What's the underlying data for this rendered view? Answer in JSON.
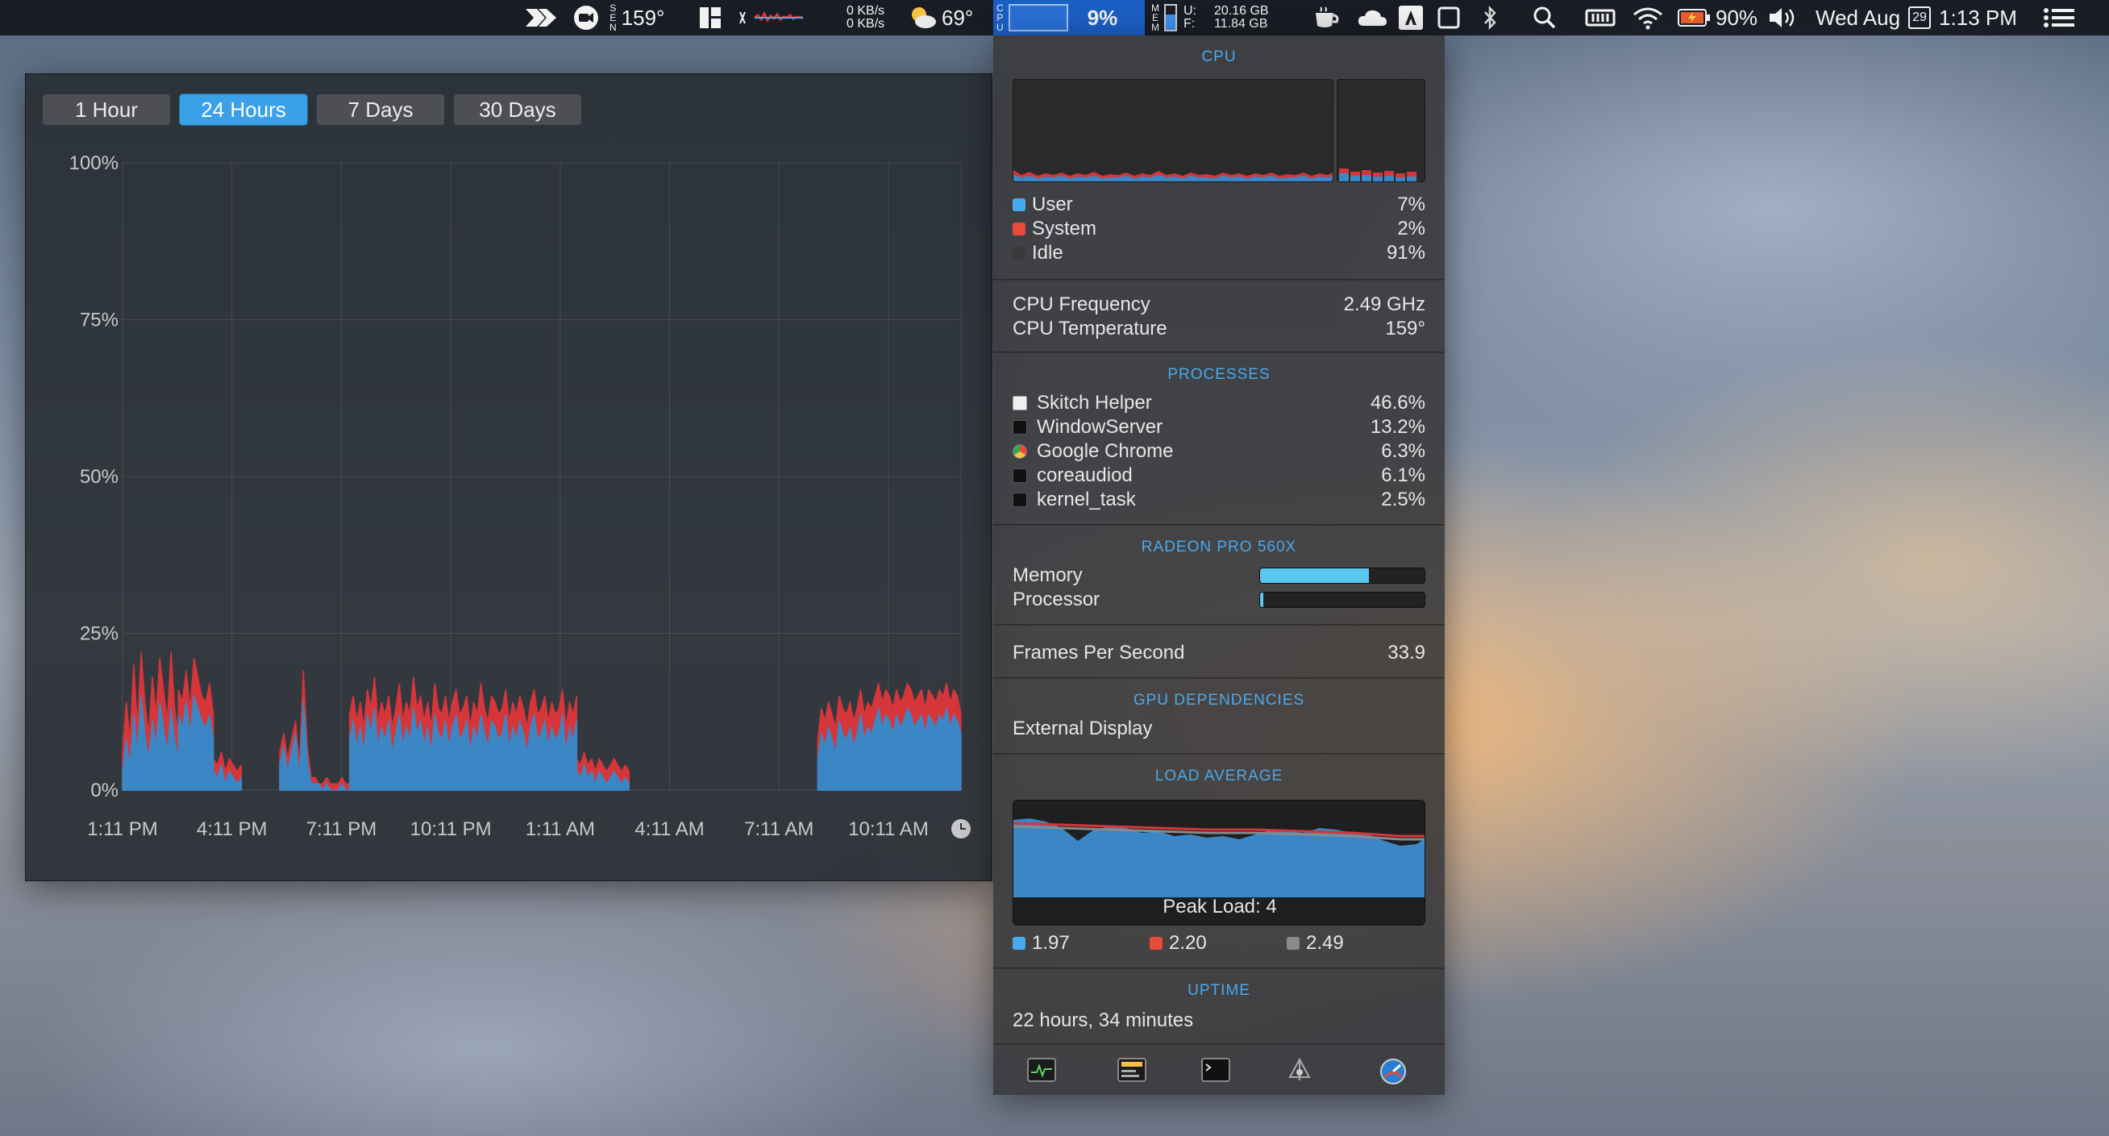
{
  "menubar": {
    "sensor_label": [
      "S",
      "E",
      "N"
    ],
    "temp": "159°",
    "net_up": "0 KB/s",
    "net_down": "0 KB/s",
    "weather": "69°",
    "cpu_label": [
      "C",
      "P",
      "U"
    ],
    "cpu_value": "9%",
    "mem_label": [
      "M",
      "E",
      "M"
    ],
    "mem_used_key": "U:",
    "mem_free_key": "F:",
    "mem_used": "20.16 GB",
    "mem_free": "11.84 GB",
    "battery": "90%",
    "date": "Wed Aug",
    "day_num": "29",
    "time": "1:13 PM"
  },
  "history": {
    "tabs": [
      {
        "label": "1 Hour",
        "active": false
      },
      {
        "label": "24 Hours",
        "active": true
      },
      {
        "label": "7 Days",
        "active": false
      },
      {
        "label": "30 Days",
        "active": false
      }
    ]
  },
  "chart_data": {
    "type": "area",
    "title": "",
    "y_ticks": [
      "100%",
      "75%",
      "50%",
      "25%",
      "0%"
    ],
    "ylim": [
      0,
      100
    ],
    "x_ticks": [
      "1:11 PM",
      "4:11 PM",
      "7:11 PM",
      "10:11 PM",
      "1:11 AM",
      "4:11 AM",
      "7:11 AM",
      "10:11 AM"
    ],
    "grid": true,
    "series": [
      {
        "color": "#3b86c4",
        "segments": [
          {
            "start": 0.0,
            "end": 1.6,
            "values": [
              3,
              8,
              4,
              12,
              6,
              15,
              9,
              5,
              11,
              7,
              14,
              10,
              6,
              13,
              8,
              5
            ]
          },
          {
            "start": 1.6,
            "end": 2.6,
            "values": [
              12,
              10,
              14,
              9,
              15,
              13,
              11,
              10,
              12,
              8
            ]
          },
          {
            "start": 2.6,
            "end": 3.4,
            "values": [
              3,
              2,
              4,
              1,
              3,
              2,
              1,
              2
            ]
          },
          {
            "start": 4.5,
            "end": 5.4,
            "values": [
              4,
              7,
              3,
              6,
              9,
              2,
              14,
              5,
              1
            ]
          },
          {
            "start": 5.4,
            "end": 6.5,
            "values": [
              1,
              1,
              1,
              0,
              1,
              0,
              0,
              0,
              1,
              0,
              0
            ]
          },
          {
            "start": 6.5,
            "end": 13.0,
            "values": [
              8,
              11,
              7,
              10,
              6,
              12,
              9,
              13,
              7,
              10,
              8,
              11,
              6,
              9,
              12,
              7,
              10,
              8,
              13,
              9,
              11,
              7,
              10,
              6,
              12,
              9,
              8,
              11,
              7,
              10,
              12,
              8,
              9,
              11,
              6,
              10,
              8,
              12,
              9,
              7,
              11,
              10,
              8,
              9,
              12,
              7,
              10,
              8,
              11,
              9,
              6,
              10,
              12,
              8,
              9,
              11,
              7,
              10,
              8,
              9,
              12,
              6,
              10,
              8,
              11
            ]
          },
          {
            "start": 13.0,
            "end": 14.5,
            "values": [
              3,
              2,
              4,
              2,
              3,
              1,
              3,
              2,
              1,
              2,
              3,
              2,
              1,
              2,
              1
            ]
          },
          {
            "start": 19.9,
            "end": 24.0,
            "values": [
              5,
              9,
              7,
              10,
              8,
              6,
              11,
              9,
              8,
              10,
              7,
              9,
              12,
              8,
              10,
              9,
              11,
              13,
              10,
              12,
              11,
              9,
              12,
              10,
              11,
              13,
              12,
              10,
              11,
              12,
              9,
              12,
              11,
              10,
              12,
              11,
              13,
              10,
              12,
              11,
              9
            ]
          }
        ]
      },
      {
        "color": "#d6363a",
        "segments": [
          {
            "start": 0.0,
            "end": 1.6,
            "values": [
              6,
              14,
              8,
              20,
              10,
              22,
              14,
              9,
              18,
              12,
              21,
              16,
              11,
              22,
              13,
              9
            ]
          },
          {
            "start": 1.6,
            "end": 2.6,
            "values": [
              16,
              14,
              19,
              13,
              21,
              18,
              15,
              14,
              17,
              12
            ]
          },
          {
            "start": 2.6,
            "end": 3.4,
            "values": [
              5,
              4,
              6,
              3,
              5,
              4,
              3,
              4
            ]
          },
          {
            "start": 4.5,
            "end": 5.4,
            "values": [
              6,
              9,
              5,
              8,
              11,
              4,
              19,
              7,
              2
            ]
          },
          {
            "start": 5.4,
            "end": 6.5,
            "values": [
              2,
              2,
              1,
              1,
              2,
              1,
              1,
              1,
              2,
              1,
              1
            ]
          },
          {
            "start": 6.5,
            "end": 13.0,
            "values": [
              12,
              15,
              11,
              14,
              10,
              16,
              13,
              18,
              11,
              14,
              12,
              15,
              10,
              13,
              17,
              11,
              14,
              12,
              18,
              13,
              15,
              11,
              14,
              10,
              17,
              13,
              12,
              15,
              11,
              14,
              16,
              12,
              13,
              15,
              10,
              14,
              12,
              17,
              13,
              11,
              15,
              14,
              12,
              13,
              16,
              11,
              14,
              12,
              15,
              13,
              10,
              14,
              16,
              12,
              13,
              15,
              11,
              14,
              12,
              13,
              16,
              10,
              14,
              12,
              15
            ]
          },
          {
            "start": 13.0,
            "end": 14.5,
            "values": [
              5,
              4,
              6,
              4,
              5,
              3,
              5,
              4,
              3,
              4,
              5,
              4,
              3,
              4,
              3
            ]
          },
          {
            "start": 19.9,
            "end": 24.0,
            "values": [
              8,
              13,
              11,
              14,
              12,
              10,
              15,
              13,
              12,
              14,
              11,
              13,
              16,
              12,
              14,
              13,
              15,
              17,
              14,
              16,
              15,
              13,
              16,
              14,
              15,
              17,
              16,
              14,
              15,
              16,
              13,
              16,
              15,
              14,
              16,
              15,
              17,
              14,
              16,
              15,
              12
            ]
          }
        ]
      }
    ]
  },
  "panel": {
    "cpu_title": "CPU",
    "legend": [
      {
        "name": "User",
        "value": "7%",
        "color": "#49a9ec"
      },
      {
        "name": "System",
        "value": "2%",
        "color": "#e84a3c"
      },
      {
        "name": "Idle",
        "value": "91%",
        "color": "#3a3a3a"
      }
    ],
    "cpu_freq_label": "CPU Frequency",
    "cpu_freq_value": "2.49 GHz",
    "cpu_temp_label": "CPU Temperature",
    "cpu_temp_value": "159°",
    "processes_title": "PROCESSES",
    "processes": [
      {
        "name": "Skitch Helper",
        "value": "46.6%",
        "icon": "skitch-icon"
      },
      {
        "name": "WindowServer",
        "value": "13.2%",
        "icon": "terminal-icon"
      },
      {
        "name": "Google Chrome",
        "value": "6.3%",
        "icon": "chrome-icon"
      },
      {
        "name": "coreaudiod",
        "value": "6.1%",
        "icon": "terminal-icon"
      },
      {
        "name": "kernel_task",
        "value": "2.5%",
        "icon": "terminal-icon"
      }
    ],
    "gpu_title": "RADEON PRO 560X",
    "gpu_memory_label": "Memory",
    "gpu_memory_fraction": 0.66,
    "gpu_processor_label": "Processor",
    "gpu_processor_fraction": 0.02,
    "fps_label": "Frames Per Second",
    "fps_value": "33.9",
    "gpu_deps_title": "GPU DEPENDENCIES",
    "gpu_dep": "External Display",
    "load_title": "LOAD AVERAGE",
    "peak_load": "Peak Load: 4",
    "load_values": [
      {
        "value": "1.97",
        "color": "#49a9ec"
      },
      {
        "value": "2.20",
        "color": "#e84a3c"
      },
      {
        "value": "2.49",
        "color": "#8a8a8a"
      }
    ],
    "uptime_title": "UPTIME",
    "uptime_value": "22 hours, 34 minutes"
  }
}
